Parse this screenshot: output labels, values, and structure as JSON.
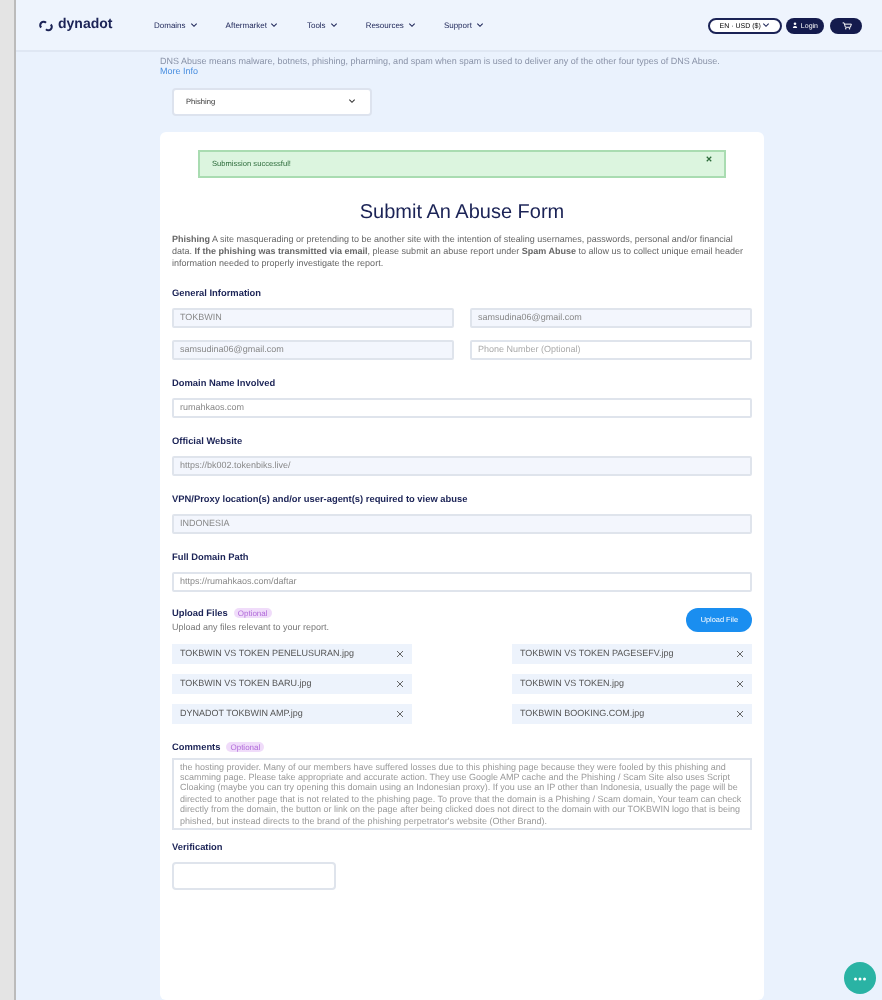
{
  "header": {
    "logo": "dynadot",
    "nav": [
      "Domains",
      "Aftermarket",
      "Tools",
      "Resources",
      "Support"
    ],
    "currency": "EN · USD ($)",
    "login": "Login"
  },
  "notice": {
    "text": "DNS Abuse means malware, botnets, phishing, pharming, and spam when spam is used to deliver any of the other four types of DNS Abuse.",
    "link": "More Info"
  },
  "abuse_type": "Phishing",
  "alert": "Submission successful!",
  "title": "Submit An Abuse Form",
  "intro": "**Phishing** A site masquerading or pretending to be another site with the intention of stealing usernames, passwords, personal and/or financial data. **If the phishing was transmitted via email**, please submit an abuse report under **Spam Abuse** to allow us to collect unique email header information needed to properly investigate the report.",
  "general": {
    "label": "General Information",
    "fields": [
      {
        "value": "TOKBWIN",
        "locked": true
      },
      {
        "value": "samsudina06@gmail.com",
        "locked": true
      },
      {
        "value": "samsudina06@gmail.com",
        "locked": true
      },
      {
        "placeholder": "Phone Number (Optional)",
        "locked": false
      }
    ]
  },
  "sections": [
    {
      "label": "Domain Name Involved",
      "value": "rumahkaos.com",
      "locked": false
    },
    {
      "label": "Official Website",
      "value": "https://bk002.tokenbiks.live/",
      "locked": true
    },
    {
      "label": "VPN/Proxy location(s) and/or user-agent(s) required to view abuse",
      "value": "INDONESIA",
      "locked": true
    },
    {
      "label": "Full Domain Path",
      "value": "https://rumahkaos.com/daftar",
      "locked": false
    }
  ],
  "upload": {
    "label": "Upload Files",
    "tag": "Optional",
    "hint": "Upload any files relevant to your report.",
    "button": "Upload File",
    "files": [
      "TOKBWIN VS TOKEN PENELUSURAN.jpg",
      "TOKBWIN VS TOKEN PAGESEFV.jpg",
      "TOKBWIN VS TOKEN BARU.jpg",
      "TOKBWIN VS TOKEN.jpg",
      "DYNADOT TOKBWIN AMP.jpg",
      "TOKBWIN BOOKING.COM.jpg"
    ]
  },
  "comments": {
    "label": "Comments",
    "tag": "Optional",
    "value": "the hosting provider. Many of our members have suffered losses due to this phishing page because they were fooled by this phishing and scamming page. Please take appropriate and accurate action. They use Google AMP cache and the Phishing / Scam Site also uses Script Cloaking (maybe you can try opening this domain using an Indonesian proxy). If you use an IP other than Indonesia, usually the page will be directed to another page that is not related to the phishing page. To prove that the domain is a Phishing / Scam domain, Your team can check directly from the domain, the button or link on the page after being clicked does not direct to the domain with our TOKBWIN logo that is being phished, but instead directs to the brand of the phishing perpetrator's website (Other Brand)."
  },
  "verification": {
    "label": "Verification"
  }
}
